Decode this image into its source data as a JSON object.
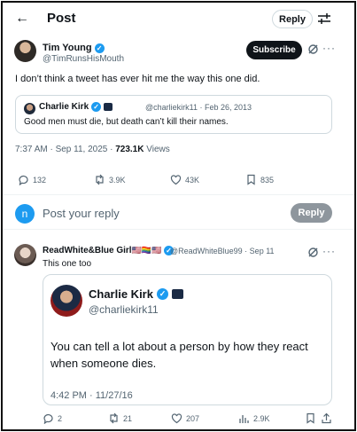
{
  "header": {
    "title": "Post",
    "reply_label": "Reply"
  },
  "tweet": {
    "author_name": "Tim Young",
    "author_handle": "@TimRunsHisMouth",
    "subscribe_label": "Subscribe",
    "text": "I don’t think a tweet has ever hit me the way this one did.",
    "quote": {
      "author_name": "Charlie Kirk",
      "handle_date": "@charliekirk11 · Feb 26, 2013",
      "text": "Good men must die, but death can’t kill their names."
    },
    "time": "7:37 AM · Sep 11, 2025 · ",
    "views": "723.1K",
    "views_label": " Views",
    "stats": {
      "replies": "132",
      "reposts": "3.9K",
      "likes": "43K",
      "bookmarks": "835"
    }
  },
  "compose": {
    "avatar_letter": "n",
    "placeholder": "Post your reply",
    "button_label": "Reply"
  },
  "reply": {
    "author_name": "ReadWhite&Blue Girl",
    "flags": "🇺🇸🏳️‍🌈🇺🇸",
    "handle_date": "@ReadWhiteBlue99 · Sep 11",
    "text": "This one too",
    "card": {
      "author_name": "Charlie Kirk",
      "author_handle": "@charliekirk11",
      "text": "You can tell a lot about a person by how they react when someone dies.",
      "date": "4:42 PM · 11/27/16"
    },
    "stats": {
      "replies": "2",
      "reposts": "21",
      "likes": "207",
      "views": "2.9K"
    }
  },
  "colors": {
    "accent": "#1d9bf0",
    "muted": "#536471",
    "text": "#0f1419"
  }
}
